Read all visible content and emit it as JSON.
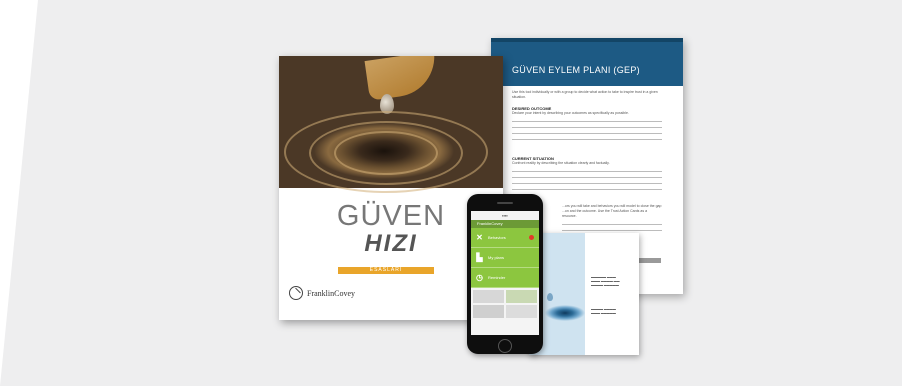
{
  "book": {
    "title_line1": "GÜVEN",
    "title_line2": "HIZI",
    "band_label": "ESASLARI",
    "publisher": "FranklinCovey"
  },
  "worksheet": {
    "title": "GÜVEN EYLEM PLANI (GEP)",
    "intro": "Use this tool individually or with a group to decide what action to take to inspire trust in a given situation.",
    "sections": [
      {
        "heading": "DESIRED OUTCOME",
        "instruction": "Declare your intent by describing your outcomes as specifically as possible."
      },
      {
        "heading": "CURRENT SITUATION",
        "instruction": "Confront reality by describing the situation clearly and factually."
      }
    ],
    "gap_text": "...ors you will take and behaviors you will model to close the gap ...on and the outcome. Use the Trust Action Cards as a resource."
  },
  "phone": {
    "app_name": "FranklinCovey",
    "menu": [
      {
        "icon": "x-icon",
        "label": "Behaviors"
      },
      {
        "icon": "chart-icon",
        "label": "My plans"
      },
      {
        "icon": "clock-icon",
        "label": "Reminder"
      }
    ]
  },
  "colors": {
    "panel": "#eeeeef",
    "worksheet_header": "#1d5a84",
    "app_green": "#8cc63f",
    "book_band": "#e9a52a"
  }
}
